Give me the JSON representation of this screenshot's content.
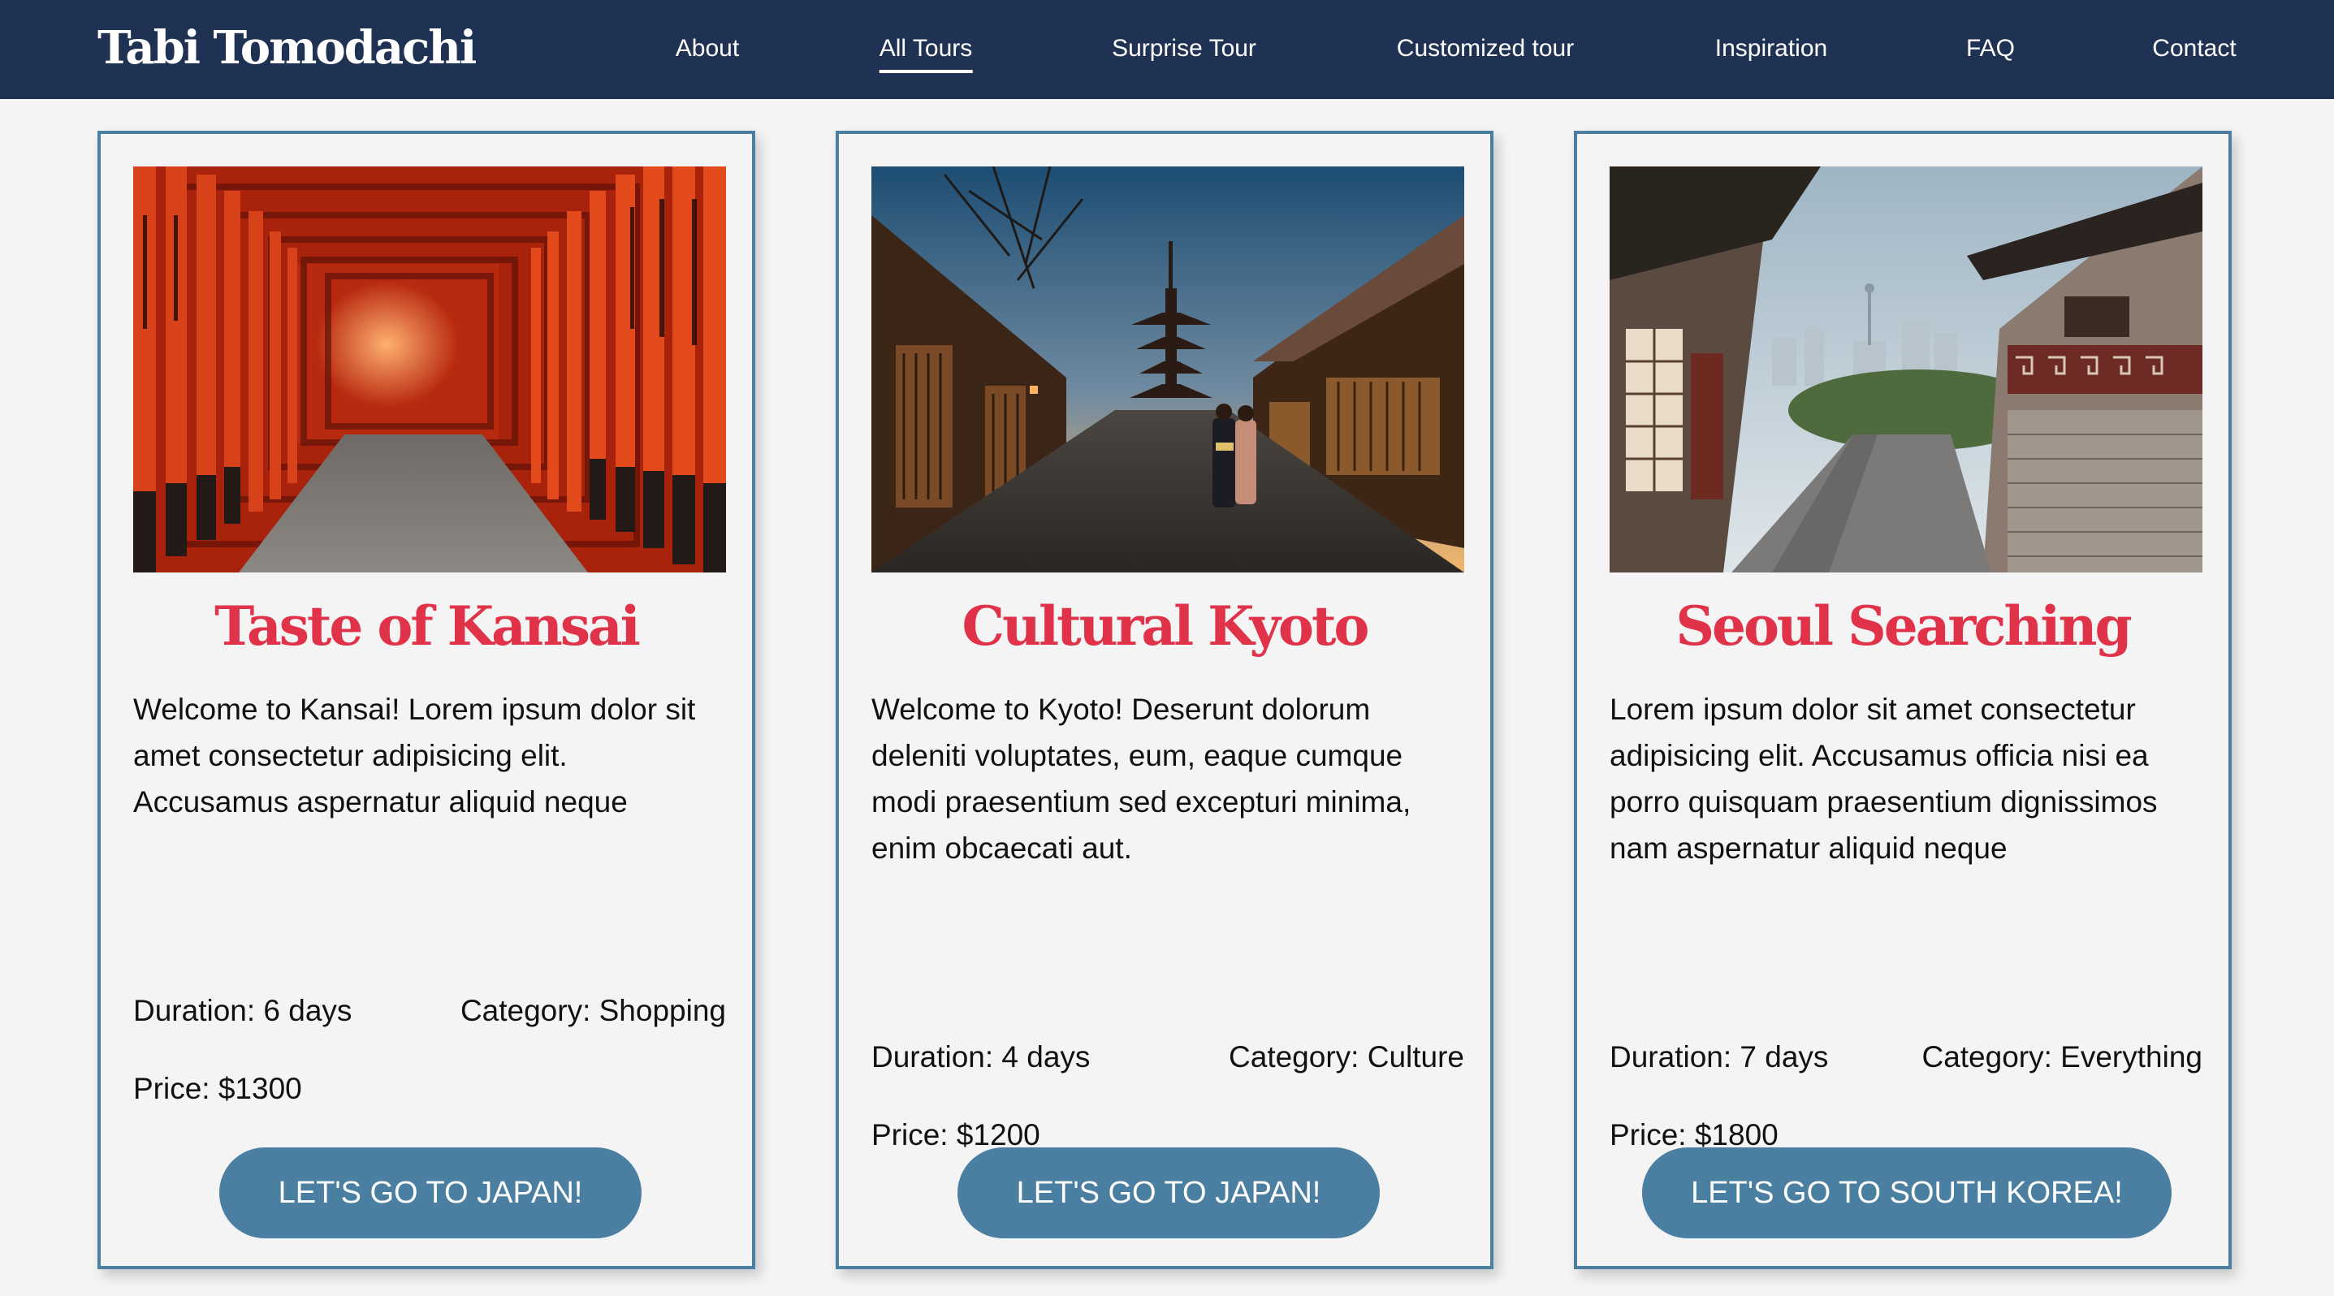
{
  "brand": "Tabi Tomodachi",
  "nav": [
    {
      "label": "About",
      "active": false
    },
    {
      "label": "All Tours",
      "active": true
    },
    {
      "label": "Surprise Tour",
      "active": false
    },
    {
      "label": "Customized tour",
      "active": false
    },
    {
      "label": "Inspiration",
      "active": false
    },
    {
      "label": "FAQ",
      "active": false
    },
    {
      "label": "Contact",
      "active": false
    }
  ],
  "tours": [
    {
      "title": "Taste of Kansai",
      "description": "Welcome to Kansai! Lorem ipsum dolor sit amet consectetur adipisicing elit. Accusamus aspernatur aliquid neque",
      "duration": "Duration: 6 days",
      "category": "Category: Shopping",
      "price": "Price: $1300",
      "cta": "LET'S GO TO JAPAN!",
      "image": "torii-gate-tunnel-photo"
    },
    {
      "title": "Cultural Kyoto",
      "description": "Welcome to Kyoto! Deserunt dolorum deleniti voluptates, eum, eaque cumque modi praesentium sed excepturi minima, enim obcaecati aut.",
      "duration": "Duration: 4 days",
      "category": "Category: Culture",
      "price": "Price: $1200",
      "cta": "LET'S GO TO JAPAN!",
      "image": "kyoto-pagoda-street-photo"
    },
    {
      "title": "Seoul Searching",
      "description": "Lorem ipsum dolor sit amet consectetur adipisicing elit. Accusamus officia nisi ea porro quisquam praesentium dignissimos nam aspernatur aliquid neque",
      "duration": "Duration: 7 days",
      "category": "Category: Everything",
      "price": "Price: $1800",
      "cta": "LET'S GO TO SOUTH KOREA!",
      "image": "seoul-hanok-alley-photo"
    }
  ],
  "colors": {
    "nav_bg": "#1f3253",
    "page_bg": "#f4f4f4",
    "accent_blue": "#4a7fa2",
    "title_red": "#e0334a"
  }
}
